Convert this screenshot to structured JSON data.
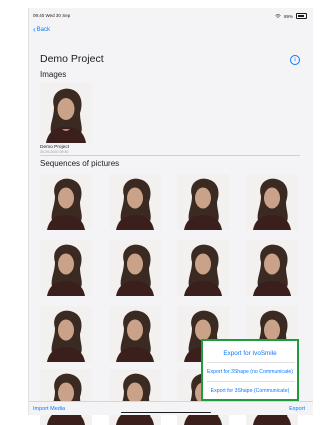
{
  "status_bar": {
    "time_date": "09:40  Wed 30 Sep",
    "battery": "89%"
  },
  "nav": {
    "back_label": "Back"
  },
  "project": {
    "title": "Demo Project"
  },
  "images_section": {
    "label": "Images",
    "items": [
      {
        "name": "Demo Project",
        "date": "30-09-2020 09:40"
      }
    ]
  },
  "sequences_section": {
    "label": "Sequences of pictures"
  },
  "toolbar": {
    "import_label": "Import Media",
    "export_label": "Export"
  },
  "export_menu": {
    "items": [
      "Export for IvoSmile",
      "Export for 3Shape (no Communicate)",
      "Export for 3Shape (Communicate)"
    ]
  }
}
